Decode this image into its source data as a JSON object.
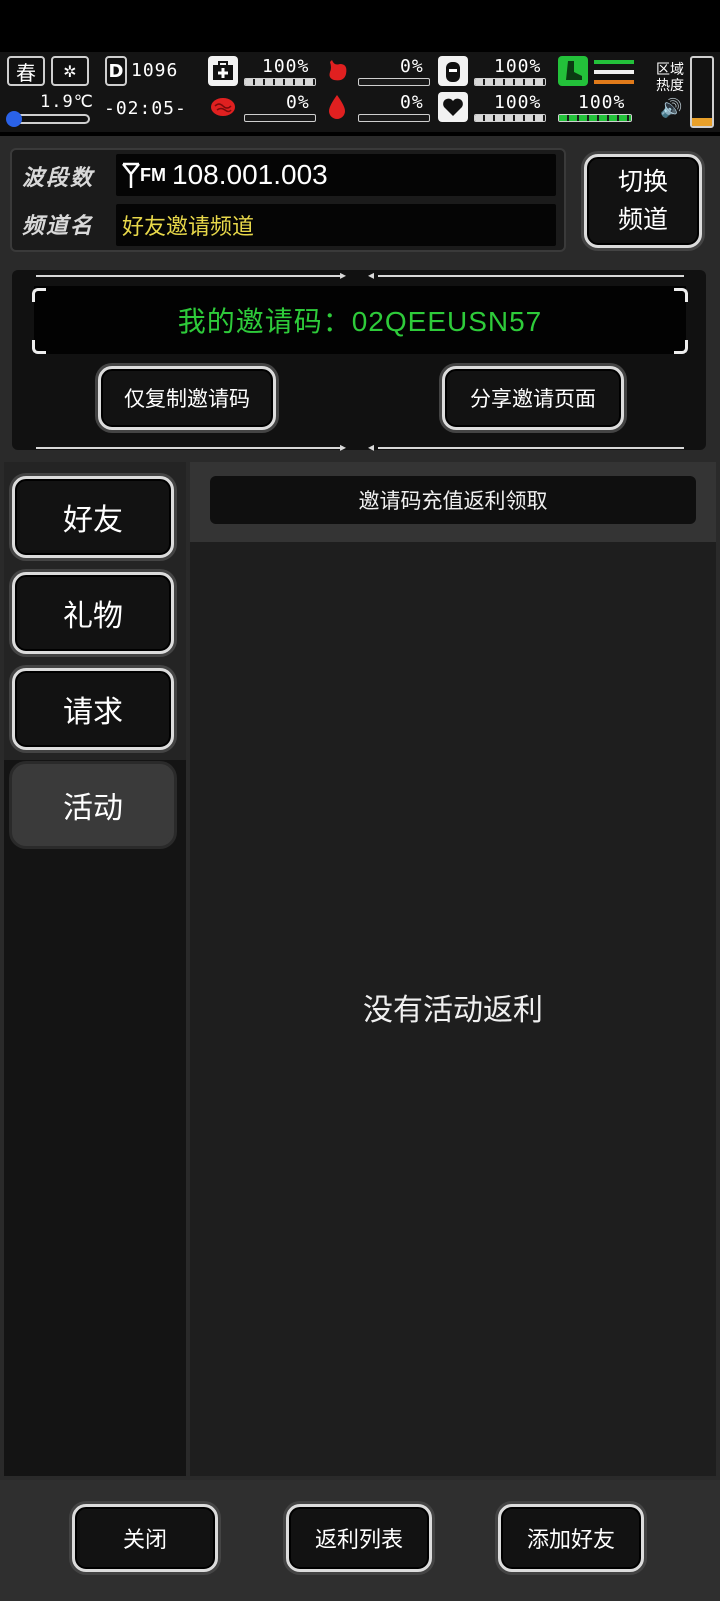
{
  "hud": {
    "season": "春",
    "temperature": "1.9℃",
    "day_count": "1096",
    "clock": "-02:05-",
    "stats": [
      {
        "name": "health",
        "value": "100%",
        "level": 1.0
      },
      {
        "name": "hunger",
        "value": "0%",
        "level": 0.0
      },
      {
        "name": "thirst",
        "value": "100%",
        "level": 1.0
      },
      {
        "name": "infection",
        "value": "0%",
        "level": 0.0
      },
      {
        "name": "bleeding",
        "value": "0%",
        "level": 0.0
      },
      {
        "name": "mood",
        "value": "100%",
        "level": 1.0
      },
      {
        "name": "stamina",
        "value": "100%",
        "level": 1.0
      }
    ],
    "region_heat_label": "区域\n热度",
    "region_heat_level": 0.12
  },
  "radio": {
    "band_label": "波段数",
    "channel_label": "频道名",
    "frequency": "108.001.003",
    "fm_label": "FM",
    "channel_name": "好友邀请频道",
    "switch_button": "切换\n频道"
  },
  "invite": {
    "code_text": "我的邀请码：02QEEUSN57",
    "copy_button": "仅复制邀请码",
    "share_button": "分享邀请页面"
  },
  "sidebar": {
    "tabs": [
      {
        "label": "好友",
        "active": false
      },
      {
        "label": "礼物",
        "active": false
      },
      {
        "label": "请求",
        "active": false
      },
      {
        "label": "活动",
        "active": true
      }
    ]
  },
  "content": {
    "sub_tab": "邀请码充值返利领取",
    "empty_message": "没有活动返利"
  },
  "bottom": {
    "close_button": "关闭",
    "rebate_list_button": "返利列表",
    "add_friend_button": "添加好友"
  },
  "colors": {
    "accent_green": "#2ecb3a",
    "channel_yellow": "#e8d84a",
    "hud_red": "#e02020"
  }
}
